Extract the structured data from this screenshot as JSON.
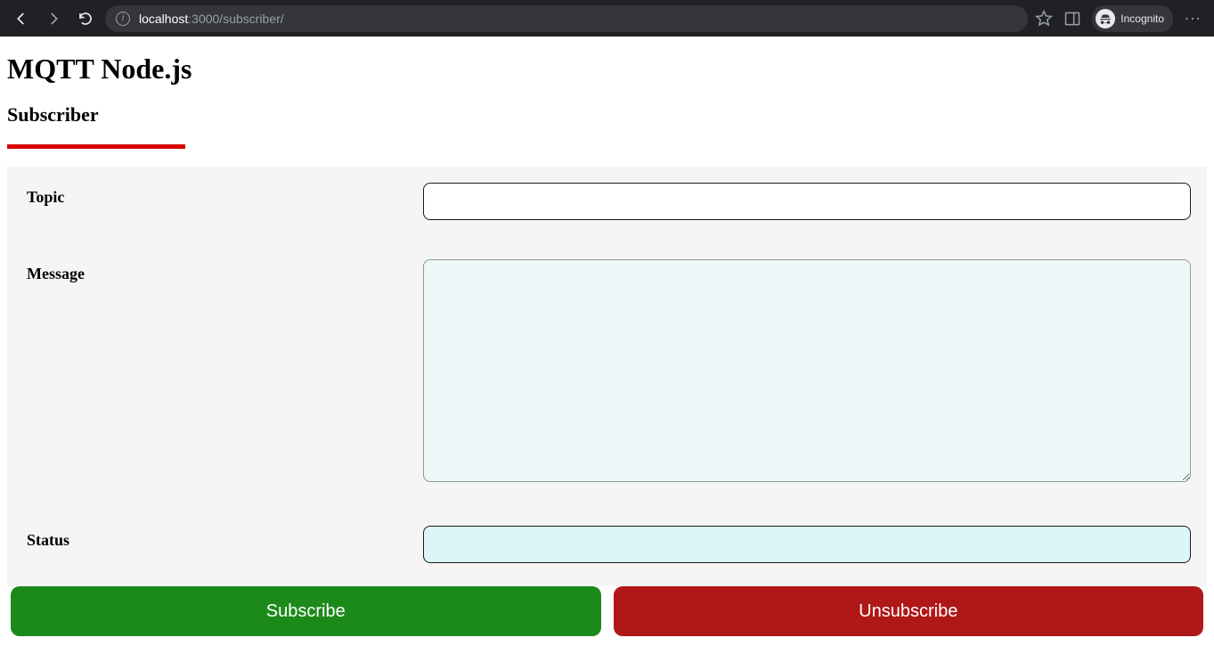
{
  "browser": {
    "url_host": "localhost",
    "url_port_path": ":3000/subscriber/",
    "incognito_label": "Incognito"
  },
  "page": {
    "title": "MQTT Node.js",
    "subtitle": "Subscriber"
  },
  "form": {
    "topic_label": "Topic",
    "topic_value": "",
    "message_label": "Message",
    "message_value": "",
    "status_label": "Status",
    "status_value": ""
  },
  "buttons": {
    "subscribe": "Subscribe",
    "unsubscribe": "Unsubscribe"
  }
}
